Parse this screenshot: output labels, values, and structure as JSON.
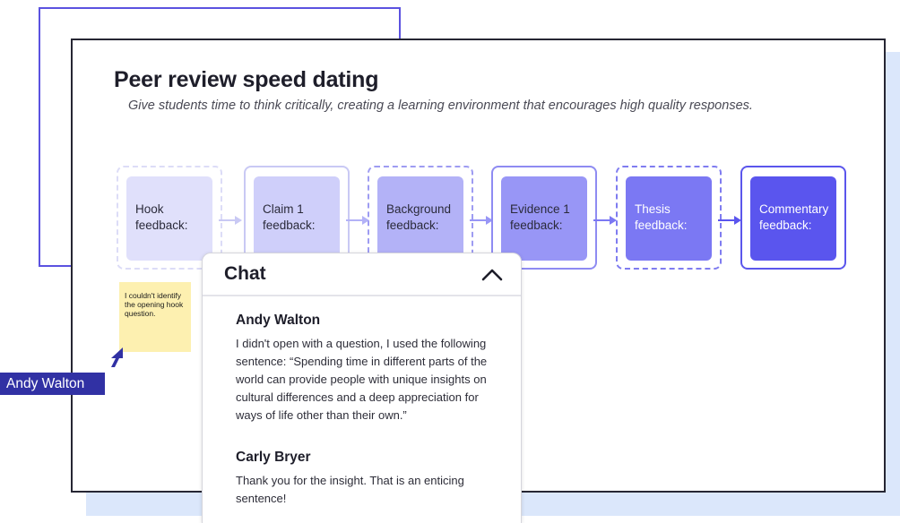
{
  "board": {
    "title": "Peer review speed dating",
    "subtitle": "Give students time to think critically, creating a learning environment that encourages high quality responses."
  },
  "steps": [
    {
      "label": "Hook feedback:",
      "card_color": "#e0e0fb",
      "frame_color": "#dcdcf7",
      "frame_style": "dashed"
    },
    {
      "label": "Claim 1 feedback:",
      "card_color": "#cfcffa",
      "frame_color": "#c9c9f4",
      "frame_style": "solid"
    },
    {
      "label": "Background feedback:",
      "card_color": "#b3b2f7",
      "frame_color": "#9e9cf2",
      "frame_style": "dashed"
    },
    {
      "label": "Evidence 1 feedback:",
      "card_color": "#9896f6",
      "frame_color": "#8e8bf2",
      "frame_style": "solid"
    },
    {
      "label": "Thesis feedback:",
      "card_color": "#7b78f3",
      "frame_color": "#7f7cf0",
      "frame_style": "dashed"
    },
    {
      "label": "Commentary feedback:",
      "card_color": "#5a55ee",
      "frame_color": "#5b56ec",
      "frame_style": "solid"
    }
  ],
  "sticky_note": {
    "text": "I couldn't identify the opening hook question.",
    "color": "#fdf0b0"
  },
  "cursor": {
    "user": "Andy Walton",
    "color": "#3131a4"
  },
  "chat": {
    "title": "Chat",
    "collapse_icon": "chevron-up-icon",
    "messages": [
      {
        "author": "Andy Walton",
        "text": "I didn't open with a question, I used the following sentence: “Spending time in different parts of the world can provide people with unique insights on cultural differences and a deep appreciation for ways of life other than their own.”"
      },
      {
        "author": "Carly Bryer",
        "text": "Thank you for the insight. That is an enticing sentence!"
      }
    ]
  },
  "colors": {
    "accent": "#5b52e0",
    "background_panel": "#dbe7fb"
  }
}
